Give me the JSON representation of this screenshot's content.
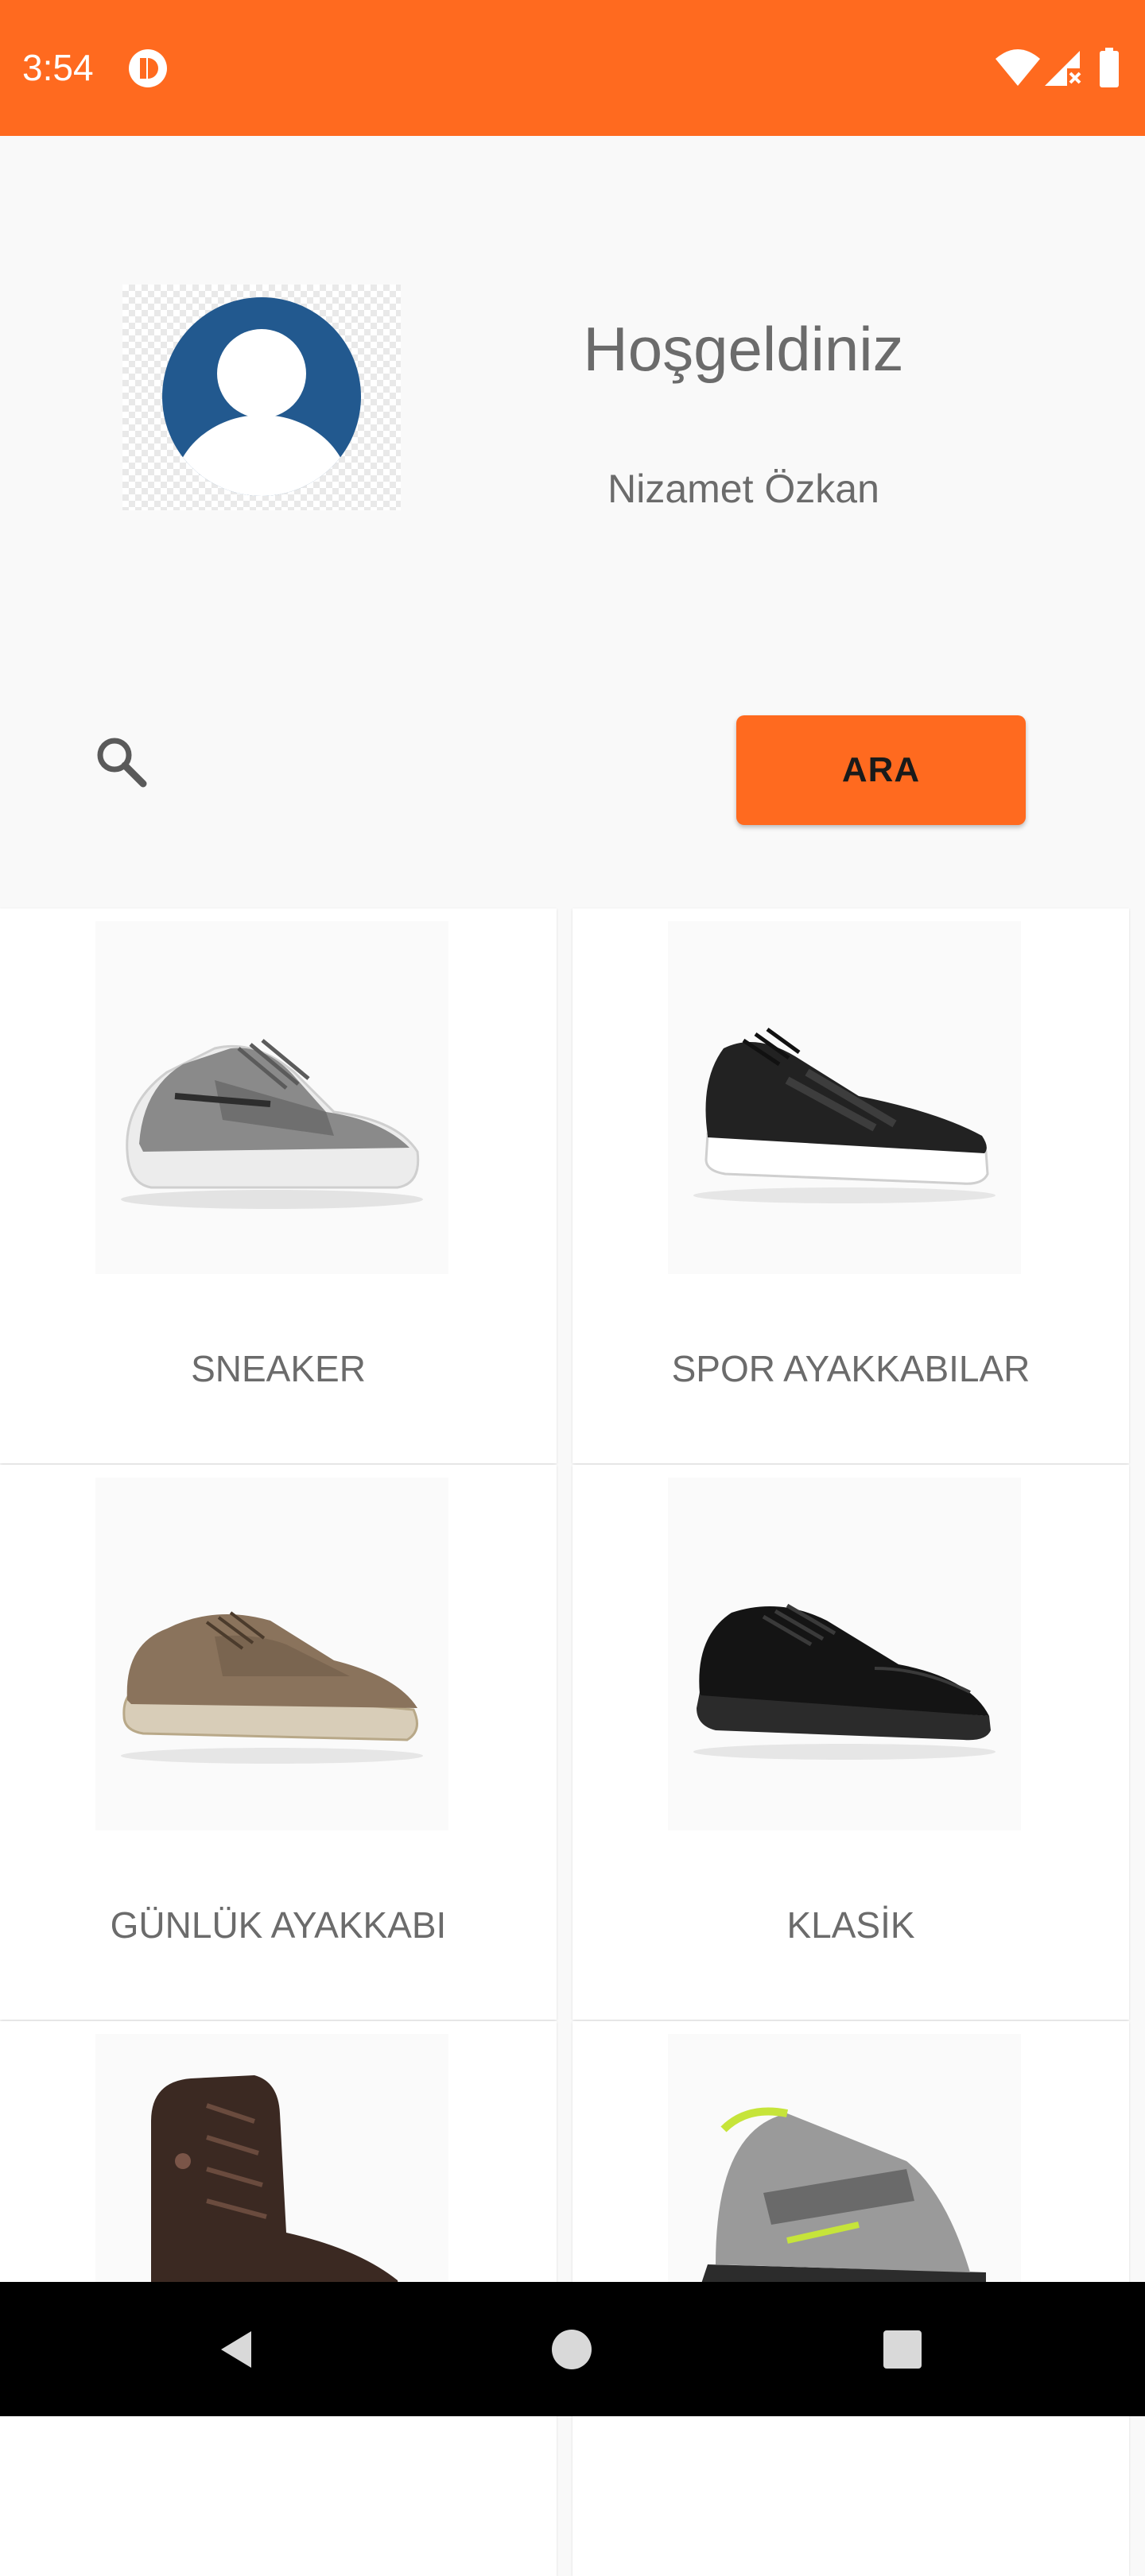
{
  "status_bar": {
    "time": "3:54"
  },
  "profile": {
    "welcome": "Hoşgeldiniz",
    "user_name": "Nizamet Özkan"
  },
  "search": {
    "placeholder": "",
    "button_label": "ARA"
  },
  "categories": [
    {
      "label": "SNEAKER",
      "image": "sneaker-shoe"
    },
    {
      "label": "SPOR AYAKKABILAR",
      "image": "sport-shoe"
    },
    {
      "label": "GÜNLÜK AYAKKABI",
      "image": "casual-shoe"
    },
    {
      "label": "KLASİK",
      "image": "classic-shoe"
    },
    {
      "label": "",
      "image": "boot"
    },
    {
      "label": "",
      "image": "sandal"
    }
  ],
  "colors": {
    "accent": "#ff6a1f",
    "text": "#6b6b6b",
    "avatar": "#22598f"
  }
}
